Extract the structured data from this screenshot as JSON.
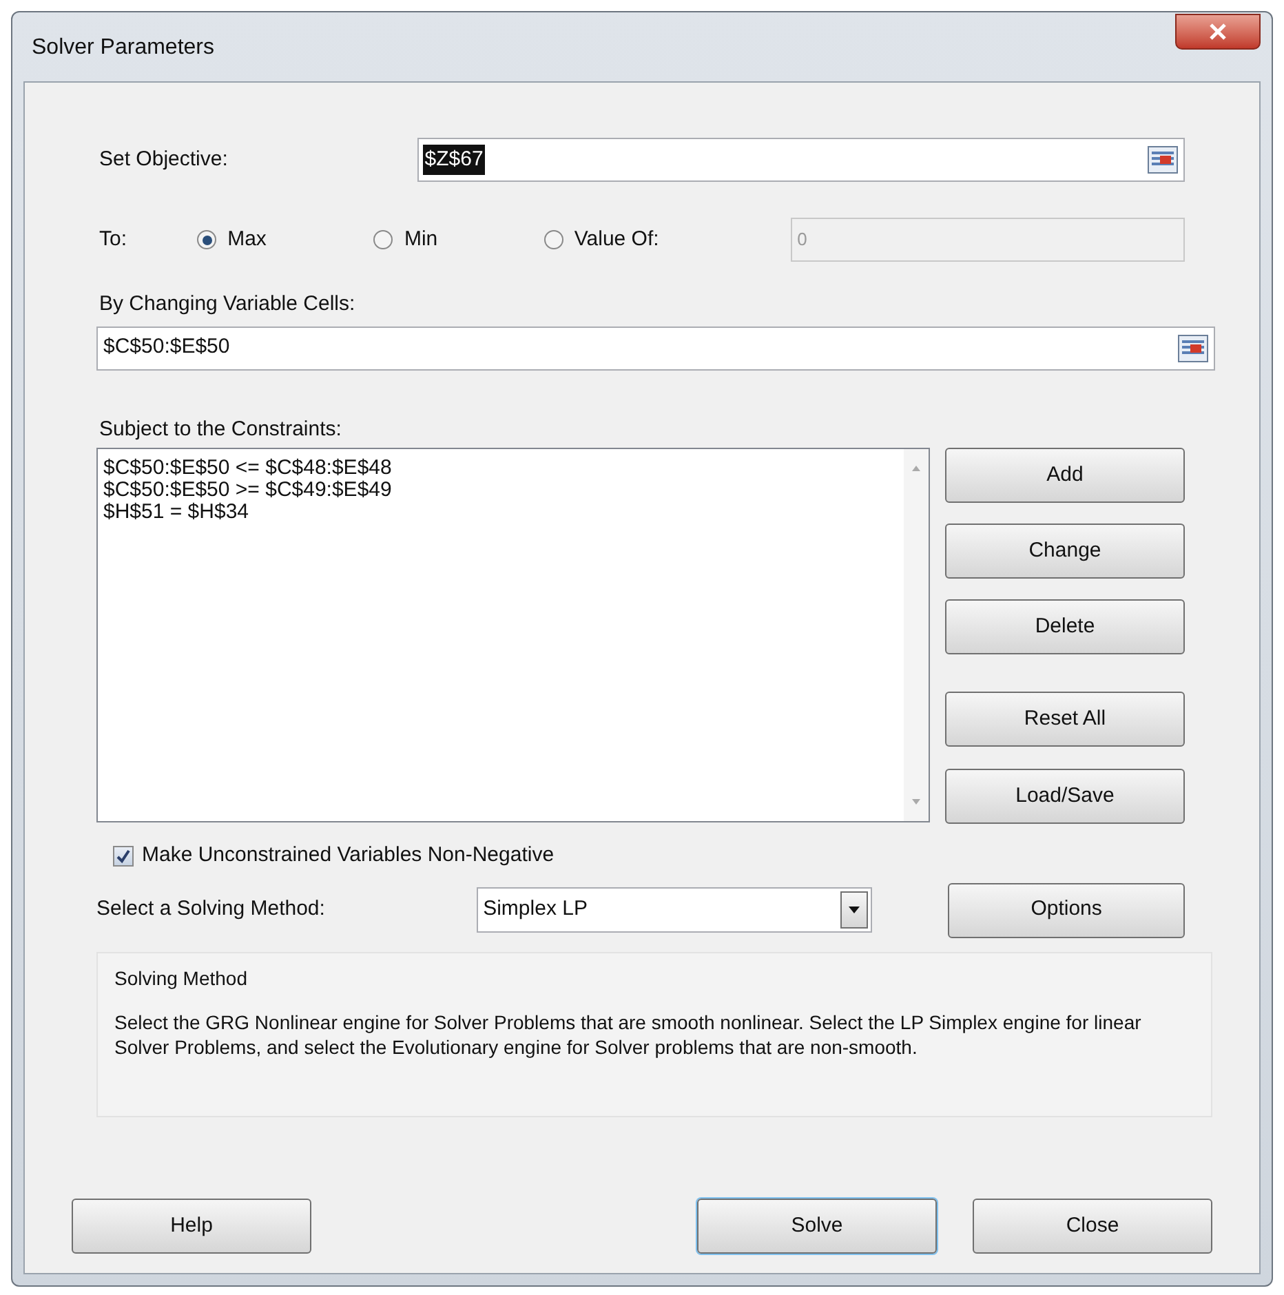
{
  "window": {
    "title": "Solver Parameters"
  },
  "objective": {
    "label": "Set Objective:",
    "value": "$Z$67",
    "highlighted": true
  },
  "to": {
    "label": "To:",
    "options": [
      {
        "label": "Max",
        "selected": true
      },
      {
        "label": "Min",
        "selected": false
      },
      {
        "label": "Value Of:",
        "selected": false
      }
    ],
    "value_of": {
      "value": "0",
      "disabled": true
    }
  },
  "variable_cells": {
    "label": "By Changing Variable Cells:",
    "value": "$C$50:$E$50"
  },
  "constraints": {
    "label": "Subject to the Constraints:",
    "items": [
      "$C$50:$E$50 <= $C$48:$E$48",
      "$C$50:$E$50 >= $C$49:$E$49",
      "$H$51 = $H$34"
    ]
  },
  "side_buttons": [
    "Add",
    "Change",
    "Delete",
    "Reset All",
    "Load/Save"
  ],
  "non_negative": {
    "label": "Make Unconstrained Variables Non-Negative",
    "checked": true
  },
  "method": {
    "label": "Select a Solving Method:",
    "value": "Simplex LP"
  },
  "options_button": "Options",
  "solving_method": {
    "title": "Solving Method",
    "text": "Select the GRG Nonlinear engine for Solver Problems that are smooth nonlinear. Select the LP Simplex engine for linear Solver Problems, and select the Evolutionary engine for Solver problems that are non-smooth."
  },
  "buttons": [
    {
      "label": "Help",
      "default": false
    },
    {
      "label": "Solve",
      "default": true
    },
    {
      "label": "Close",
      "default": false
    }
  ]
}
